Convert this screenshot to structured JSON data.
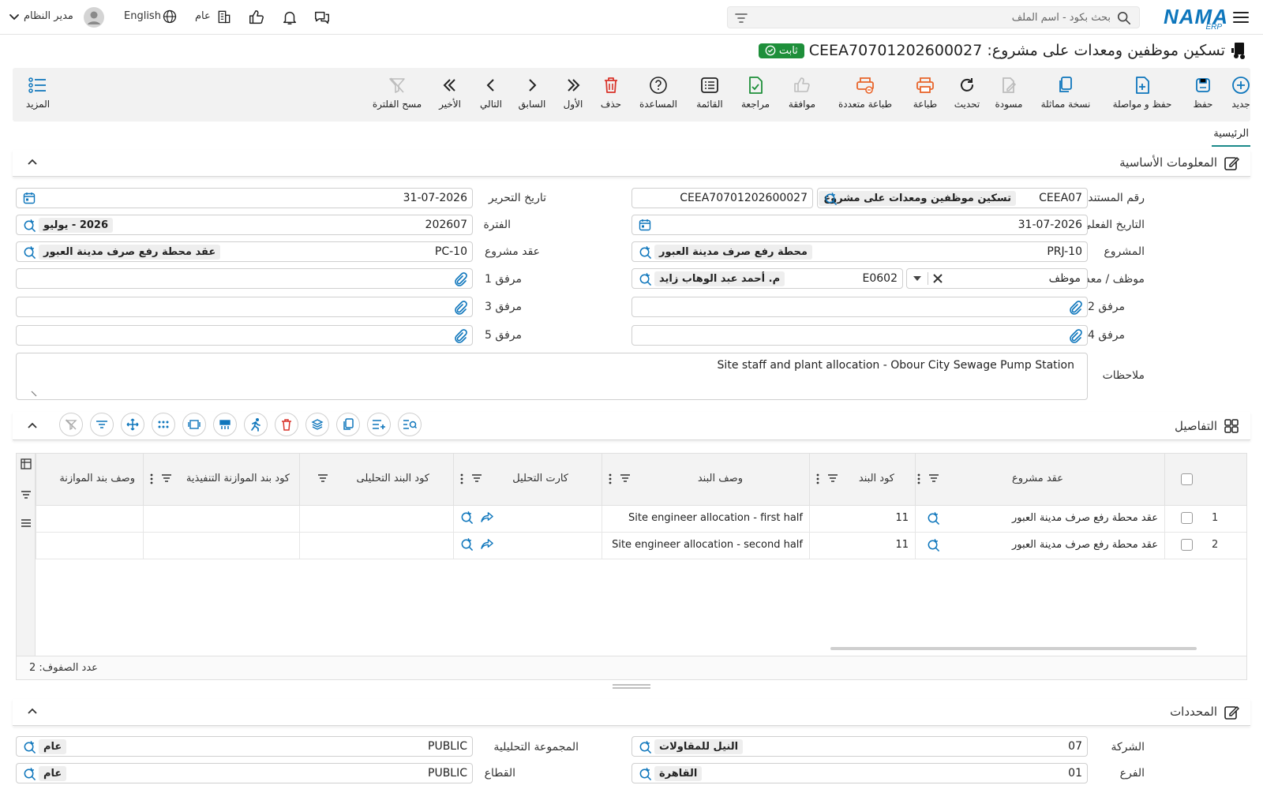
{
  "topbar": {
    "logo_main": "NAMA",
    "logo_sub": "ERP",
    "search_placeholder": "بحث بكود - اسم الملف",
    "company_label": "عام",
    "language_label": "English",
    "user_label": "مدير النظام"
  },
  "document": {
    "title": "تسكين موظفين ومعدات على مشروع: CEEA70701202600027",
    "status": "ثابت"
  },
  "toolbar": {
    "new": "جديد",
    "save": "حفظ",
    "save_continue": "حفظ و مواصلة",
    "duplicate": "نسخة مماثلة",
    "draft": "مسودة",
    "refresh": "تحديث",
    "print": "طباعة",
    "multi_print": "طباعة متعددة",
    "approve": "موافقة",
    "review": "مراجعة",
    "list": "القائمة",
    "help": "المساعدة",
    "delete": "حذف",
    "first": "الأول",
    "previous": "السابق",
    "next": "التالي",
    "last": "الأخير",
    "clear_filter": "مسح الفلترة",
    "more": "المزيد"
  },
  "tabs": {
    "main": "الرئيسية"
  },
  "basic_info": {
    "section_title": "المعلومات الأساسية",
    "doc_number": {
      "label": "رقم المستند",
      "code": "CEEA07",
      "name": "تسكين موظفين ومعدات على مشروع",
      "number": "CEEA70701202600027"
    },
    "issue_date": {
      "label": "تاريخ التحرير",
      "value": "31-07-2026"
    },
    "actual_date": {
      "label": "التاريخ الفعلي",
      "value": "31-07-2026"
    },
    "period": {
      "label": "الفترة",
      "code": "202607",
      "name": "2026 - يوليو"
    },
    "project": {
      "label": "المشروع",
      "code": "PRJ-10",
      "name": "محطة رفع صرف مدينة العبور"
    },
    "project_contract": {
      "label": "عقد مشروع",
      "code": "PC-10",
      "name": "عقد محطة رفع صرف مدينة العبور"
    },
    "employee_equipment": {
      "label": "موظف / معدة",
      "type": "موظف",
      "code": "E0602",
      "name": "م. أحمد عبد الوهاب زايد"
    },
    "attachment1": {
      "label": "مرفق 1"
    },
    "attachment2": {
      "label": "مرفق 2"
    },
    "attachment3": {
      "label": "مرفق 3"
    },
    "attachment4": {
      "label": "مرفق 4"
    },
    "attachment5": {
      "label": "مرفق 5"
    },
    "notes": {
      "label": "ملاحظات",
      "value": "Site staff and plant allocation - Obour City Sewage Pump Station"
    }
  },
  "details": {
    "section_title": "التفاصيل",
    "columns": {
      "contract": "عقد مشروع",
      "item_code": "كود البند",
      "item_desc": "وصف البند",
      "analysis_card": "كارت التحليل",
      "analytic_item_code": "كود البند التحليلى",
      "exec_budget_code": "كود بند الموازنة التنفيذية",
      "budget_item_desc": "وصف بند الموازنة"
    },
    "rows": [
      {
        "num": "1",
        "contract": "عقد محطة رفع صرف مدينة العبور",
        "item_code": "11",
        "item_desc": "Site engineer allocation - first half"
      },
      {
        "num": "2",
        "contract": "عقد محطة رفع صرف مدينة العبور",
        "item_code": "11",
        "item_desc": "Site engineer allocation - second half"
      }
    ],
    "row_count": "عدد الصفوف: 2"
  },
  "dimensions": {
    "section_title": "المحددات",
    "company": {
      "label": "الشركة",
      "code": "07",
      "name": "النيل للمقاولات"
    },
    "analytic_group": {
      "label": "المجموعة التحليلية",
      "code": "PUBLIC",
      "name": "عام"
    },
    "branch": {
      "label": "الفرع",
      "code": "01",
      "name": "القاهرة"
    },
    "sector": {
      "label": "القطاع",
      "code": "PUBLIC",
      "name": "عام"
    }
  },
  "colors": {
    "accent": "#0e76bc",
    "teal": "#1a8a8a",
    "status_green": "#1e8f3a",
    "danger": "#d9342b",
    "print_orange": "#e8642a"
  }
}
